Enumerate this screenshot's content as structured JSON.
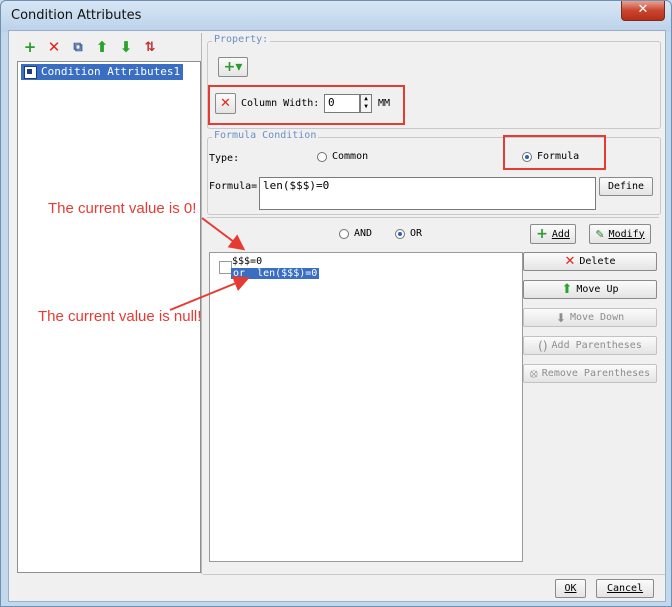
{
  "window": {
    "title": "Condition Attributes",
    "close_glyph": "✕"
  },
  "left_toolbar": [
    {
      "icon": "add-icon",
      "glyph": "+"
    },
    {
      "icon": "delete-icon",
      "glyph": "✕"
    },
    {
      "icon": "copy-icon",
      "glyph": "⧉"
    },
    {
      "icon": "move-up-icon",
      "glyph": "⬆"
    },
    {
      "icon": "move-down-icon",
      "glyph": "⬇"
    },
    {
      "icon": "sort-icon",
      "glyph": "⇅"
    }
  ],
  "tree": {
    "items": [
      "Condition Attributes1"
    ]
  },
  "property": {
    "legend": "Property:",
    "add_glyph": "+▾",
    "column_width_label": "Column Width:",
    "column_width_value": "0",
    "unit": "MM"
  },
  "formula_condition": {
    "legend": "Formula Condition",
    "type_label": "Type:",
    "options": [
      "Common",
      "Formula"
    ],
    "selected": "Formula",
    "formula_label": "Formula=",
    "formula_value": "len($$$)=0",
    "define_label": "Define"
  },
  "logic": {
    "options": [
      "AND",
      "OR"
    ],
    "selected": "OR",
    "add_label": "Add",
    "modify_label": "Modify"
  },
  "conditions": {
    "items": [
      "$$$=0",
      "or  len($$$)=0"
    ],
    "selected_index": 1
  },
  "actions": {
    "delete": "Delete",
    "move_up": "Move Up",
    "move_down": "Move Down",
    "add_parentheses": "Add Parentheses",
    "remove_parentheses": "Remove Parentheses"
  },
  "annotations": {
    "first": "The current value is 0!",
    "second": "The current value is null!"
  },
  "footer": {
    "ok": "OK",
    "cancel": "Cancel"
  },
  "colors": {
    "accent": "#3a6ec2",
    "annotation": "#e53b33"
  }
}
